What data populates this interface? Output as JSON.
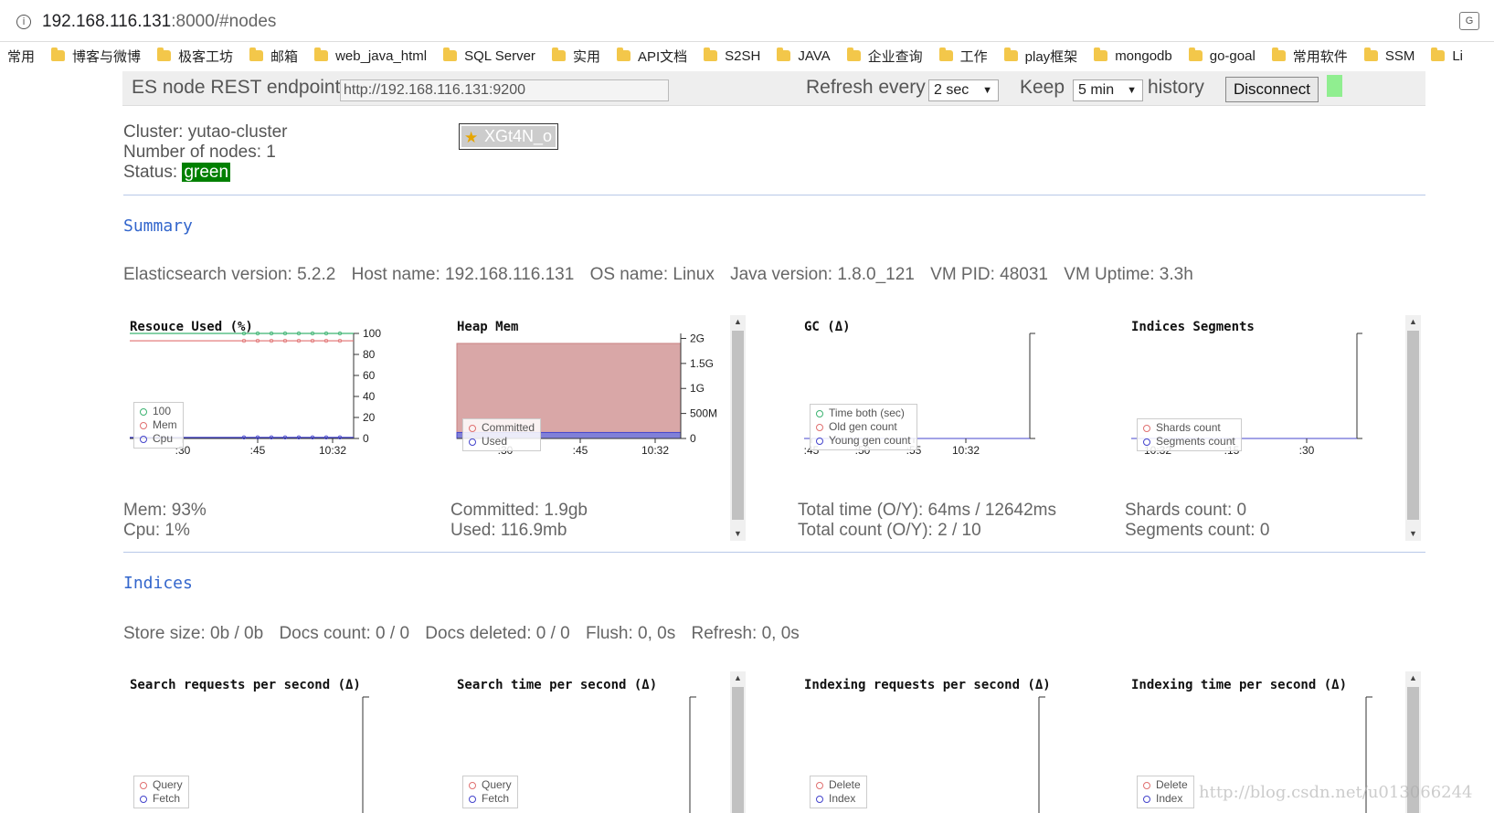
{
  "browser": {
    "url_host": "192.168.116.131",
    "url_rest": ":8000/#nodes",
    "translate_icon": "translate-icon",
    "bookmarks": [
      "常用",
      "博客与微博",
      "极客工坊",
      "邮箱",
      "web_java_html",
      "SQL Server",
      "实用",
      "API文档",
      "S2SH",
      "JAVA",
      "企业查询",
      "工作",
      "play框架",
      "mongodb",
      "go-goal",
      "常用软件",
      "SSM",
      "Li"
    ]
  },
  "controls": {
    "endpoint_label": "ES node REST endpoint",
    "endpoint_value": "http://192.168.116.131:9200",
    "refresh_label": "Refresh every",
    "refresh_value": "2 sec",
    "keep_label": "Keep",
    "keep_value": "5 min",
    "history_label": "history",
    "disconnect_label": "Disconnect",
    "status_color": "#90ee90"
  },
  "cluster": {
    "name_line": "Cluster: yutao-cluster",
    "nodes_line": "Number of nodes: 1",
    "status_label": "Status:",
    "status_value": "green",
    "node_name": "XGt4N_o"
  },
  "summary": {
    "title": "Summary",
    "es_version": "Elasticsearch version: 5.2.2",
    "host_name": "Host name: 192.168.116.131",
    "os_name": "OS name: Linux",
    "java_version": "Java version: 1.8.0_121",
    "vm_pid": "VM PID: 48031",
    "vm_uptime": "VM Uptime: 3.3h"
  },
  "charts": {
    "resource": {
      "title": "Resouce Used (%)",
      "y_ticks": [
        "100",
        "80",
        "60",
        "40",
        "20",
        "0"
      ],
      "x_ticks": [
        ":30",
        ":45",
        "10:32"
      ],
      "legend": [
        "100",
        "Mem",
        "Cpu"
      ],
      "stat_mem": "Mem: 93%",
      "stat_cpu": "Cpu: 1%"
    },
    "heap": {
      "title": "Heap Mem",
      "y_ticks": [
        "2G",
        "1.5G",
        "1G",
        "500M",
        "0"
      ],
      "x_ticks": [
        ":30",
        ":45",
        "10:32"
      ],
      "legend": [
        "Committed",
        "Used"
      ],
      "stat_committed": "Committed: 1.9gb",
      "stat_used": "Used: 116.9mb"
    },
    "gc": {
      "title": "GC (Δ)",
      "x_ticks": [
        ":45",
        ":50",
        ":55",
        "10:32"
      ],
      "legend": [
        "Time both (sec)",
        "Old gen count",
        "Young gen count"
      ],
      "stat_time": "Total time (O/Y): 64ms / 12642ms",
      "stat_count": "Total count (O/Y): 2 / 10"
    },
    "segments": {
      "title": "Indices Segments",
      "x_ticks": [
        "10:32",
        ":15",
        ":30"
      ],
      "legend": [
        "Shards count",
        "Segments count"
      ],
      "stat_shards": "Shards count: 0",
      "stat_segments": "Segments count: 0"
    }
  },
  "indices": {
    "title": "Indices",
    "store_size": "Store size: 0b / 0b",
    "docs_count": "Docs count: 0 / 0",
    "docs_deleted": "Docs deleted: 0 / 0",
    "flush": "Flush: 0, 0s",
    "refresh": "Refresh: 0, 0s",
    "search_req_title": "Search requests per second (Δ)",
    "search_req_legend": [
      "Query",
      "Fetch"
    ],
    "search_time_title": "Search time per second (Δ)",
    "search_time_legend": [
      "Query",
      "Fetch"
    ],
    "index_req_title": "Indexing requests per second (Δ)",
    "index_req_legend": [
      "Delete",
      "Index"
    ],
    "index_time_title": "Indexing time per second (Δ)",
    "index_time_legend": [
      "Delete",
      "Index"
    ]
  },
  "chart_data": [
    {
      "type": "line",
      "title": "Resouce Used (%)",
      "ylim": [
        0,
        100
      ],
      "x": [
        ":30",
        ":45",
        "10:32"
      ],
      "series": [
        {
          "name": "100",
          "values": [
            100,
            100,
            100
          ]
        },
        {
          "name": "Mem",
          "values": [
            93,
            93,
            93
          ]
        },
        {
          "name": "Cpu",
          "values": [
            1,
            1,
            1
          ]
        }
      ],
      "legend": "bottom-left"
    },
    {
      "type": "area",
      "title": "Heap Mem",
      "ylim": [
        0,
        2.1
      ],
      "y_unit": "G",
      "x": [
        ":30",
        ":45",
        "10:32"
      ],
      "series": [
        {
          "name": "Committed",
          "values": [
            1.9,
            1.9,
            1.9
          ]
        },
        {
          "name": "Used",
          "values": [
            0.12,
            0.12,
            0.12
          ]
        }
      ],
      "legend": "bottom-left"
    },
    {
      "type": "line",
      "title": "GC (Δ)",
      "x": [
        ":45",
        ":50",
        ":55",
        "10:32"
      ],
      "series": [
        {
          "name": "Time both (sec)",
          "values": [
            0,
            0,
            0,
            0
          ]
        },
        {
          "name": "Old gen count",
          "values": [
            0,
            0,
            0,
            0
          ]
        },
        {
          "name": "Young gen count",
          "values": [
            0,
            0,
            0,
            0
          ]
        }
      ],
      "legend": "bottom-left"
    },
    {
      "type": "line",
      "title": "Indices Segments",
      "x": [
        "10:32",
        ":15",
        ":30"
      ],
      "series": [
        {
          "name": "Shards count",
          "values": [
            0,
            0,
            0
          ]
        },
        {
          "name": "Segments count",
          "values": [
            0,
            0,
            0
          ]
        }
      ],
      "legend": "bottom-left"
    }
  ],
  "colors": {
    "green_line": "#3cb371",
    "red_line": "#e07070",
    "blue_line": "#4444cc",
    "committed_fill": "#d9a7a7",
    "used_fill": "#8080d8"
  },
  "watermark": "http://blog.csdn.net/u013066244"
}
